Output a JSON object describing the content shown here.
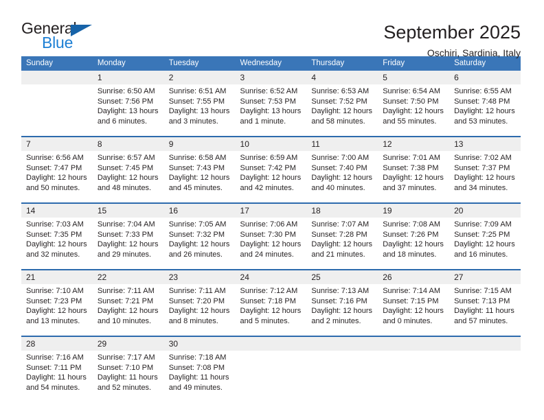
{
  "brand": {
    "word_one": "General",
    "word_two": "Blue",
    "triangle_icon": "triangle-icon",
    "accent_color": "#1763a8",
    "blue_color": "#1c7fd4"
  },
  "header": {
    "title": "September 2025",
    "location": "Oschiri, Sardinia, Italy"
  },
  "calendar": {
    "header_bg": "#3a76b8",
    "header_text_color": "#ffffff",
    "row_divider_color": "#2c6aad",
    "daynum_bg": "#efefef",
    "columns": [
      "Sunday",
      "Monday",
      "Tuesday",
      "Wednesday",
      "Thursday",
      "Friday",
      "Saturday"
    ],
    "weeks": [
      [
        {
          "day": "",
          "sunrise": "",
          "sunset": "",
          "daylight_a": "",
          "daylight_b": ""
        },
        {
          "day": "1",
          "sunrise": "Sunrise: 6:50 AM",
          "sunset": "Sunset: 7:56 PM",
          "daylight_a": "Daylight: 13 hours",
          "daylight_b": "and 6 minutes."
        },
        {
          "day": "2",
          "sunrise": "Sunrise: 6:51 AM",
          "sunset": "Sunset: 7:55 PM",
          "daylight_a": "Daylight: 13 hours",
          "daylight_b": "and 3 minutes."
        },
        {
          "day": "3",
          "sunrise": "Sunrise: 6:52 AM",
          "sunset": "Sunset: 7:53 PM",
          "daylight_a": "Daylight: 13 hours",
          "daylight_b": "and 1 minute."
        },
        {
          "day": "4",
          "sunrise": "Sunrise: 6:53 AM",
          "sunset": "Sunset: 7:52 PM",
          "daylight_a": "Daylight: 12 hours",
          "daylight_b": "and 58 minutes."
        },
        {
          "day": "5",
          "sunrise": "Sunrise: 6:54 AM",
          "sunset": "Sunset: 7:50 PM",
          "daylight_a": "Daylight: 12 hours",
          "daylight_b": "and 55 minutes."
        },
        {
          "day": "6",
          "sunrise": "Sunrise: 6:55 AM",
          "sunset": "Sunset: 7:48 PM",
          "daylight_a": "Daylight: 12 hours",
          "daylight_b": "and 53 minutes."
        }
      ],
      [
        {
          "day": "7",
          "sunrise": "Sunrise: 6:56 AM",
          "sunset": "Sunset: 7:47 PM",
          "daylight_a": "Daylight: 12 hours",
          "daylight_b": "and 50 minutes."
        },
        {
          "day": "8",
          "sunrise": "Sunrise: 6:57 AM",
          "sunset": "Sunset: 7:45 PM",
          "daylight_a": "Daylight: 12 hours",
          "daylight_b": "and 48 minutes."
        },
        {
          "day": "9",
          "sunrise": "Sunrise: 6:58 AM",
          "sunset": "Sunset: 7:43 PM",
          "daylight_a": "Daylight: 12 hours",
          "daylight_b": "and 45 minutes."
        },
        {
          "day": "10",
          "sunrise": "Sunrise: 6:59 AM",
          "sunset": "Sunset: 7:42 PM",
          "daylight_a": "Daylight: 12 hours",
          "daylight_b": "and 42 minutes."
        },
        {
          "day": "11",
          "sunrise": "Sunrise: 7:00 AM",
          "sunset": "Sunset: 7:40 PM",
          "daylight_a": "Daylight: 12 hours",
          "daylight_b": "and 40 minutes."
        },
        {
          "day": "12",
          "sunrise": "Sunrise: 7:01 AM",
          "sunset": "Sunset: 7:38 PM",
          "daylight_a": "Daylight: 12 hours",
          "daylight_b": "and 37 minutes."
        },
        {
          "day": "13",
          "sunrise": "Sunrise: 7:02 AM",
          "sunset": "Sunset: 7:37 PM",
          "daylight_a": "Daylight: 12 hours",
          "daylight_b": "and 34 minutes."
        }
      ],
      [
        {
          "day": "14",
          "sunrise": "Sunrise: 7:03 AM",
          "sunset": "Sunset: 7:35 PM",
          "daylight_a": "Daylight: 12 hours",
          "daylight_b": "and 32 minutes."
        },
        {
          "day": "15",
          "sunrise": "Sunrise: 7:04 AM",
          "sunset": "Sunset: 7:33 PM",
          "daylight_a": "Daylight: 12 hours",
          "daylight_b": "and 29 minutes."
        },
        {
          "day": "16",
          "sunrise": "Sunrise: 7:05 AM",
          "sunset": "Sunset: 7:32 PM",
          "daylight_a": "Daylight: 12 hours",
          "daylight_b": "and 26 minutes."
        },
        {
          "day": "17",
          "sunrise": "Sunrise: 7:06 AM",
          "sunset": "Sunset: 7:30 PM",
          "daylight_a": "Daylight: 12 hours",
          "daylight_b": "and 24 minutes."
        },
        {
          "day": "18",
          "sunrise": "Sunrise: 7:07 AM",
          "sunset": "Sunset: 7:28 PM",
          "daylight_a": "Daylight: 12 hours",
          "daylight_b": "and 21 minutes."
        },
        {
          "day": "19",
          "sunrise": "Sunrise: 7:08 AM",
          "sunset": "Sunset: 7:26 PM",
          "daylight_a": "Daylight: 12 hours",
          "daylight_b": "and 18 minutes."
        },
        {
          "day": "20",
          "sunrise": "Sunrise: 7:09 AM",
          "sunset": "Sunset: 7:25 PM",
          "daylight_a": "Daylight: 12 hours",
          "daylight_b": "and 16 minutes."
        }
      ],
      [
        {
          "day": "21",
          "sunrise": "Sunrise: 7:10 AM",
          "sunset": "Sunset: 7:23 PM",
          "daylight_a": "Daylight: 12 hours",
          "daylight_b": "and 13 minutes."
        },
        {
          "day": "22",
          "sunrise": "Sunrise: 7:11 AM",
          "sunset": "Sunset: 7:21 PM",
          "daylight_a": "Daylight: 12 hours",
          "daylight_b": "and 10 minutes."
        },
        {
          "day": "23",
          "sunrise": "Sunrise: 7:11 AM",
          "sunset": "Sunset: 7:20 PM",
          "daylight_a": "Daylight: 12 hours",
          "daylight_b": "and 8 minutes."
        },
        {
          "day": "24",
          "sunrise": "Sunrise: 7:12 AM",
          "sunset": "Sunset: 7:18 PM",
          "daylight_a": "Daylight: 12 hours",
          "daylight_b": "and 5 minutes."
        },
        {
          "day": "25",
          "sunrise": "Sunrise: 7:13 AM",
          "sunset": "Sunset: 7:16 PM",
          "daylight_a": "Daylight: 12 hours",
          "daylight_b": "and 2 minutes."
        },
        {
          "day": "26",
          "sunrise": "Sunrise: 7:14 AM",
          "sunset": "Sunset: 7:15 PM",
          "daylight_a": "Daylight: 12 hours",
          "daylight_b": "and 0 minutes."
        },
        {
          "day": "27",
          "sunrise": "Sunrise: 7:15 AM",
          "sunset": "Sunset: 7:13 PM",
          "daylight_a": "Daylight: 11 hours",
          "daylight_b": "and 57 minutes."
        }
      ],
      [
        {
          "day": "28",
          "sunrise": "Sunrise: 7:16 AM",
          "sunset": "Sunset: 7:11 PM",
          "daylight_a": "Daylight: 11 hours",
          "daylight_b": "and 54 minutes."
        },
        {
          "day": "29",
          "sunrise": "Sunrise: 7:17 AM",
          "sunset": "Sunset: 7:10 PM",
          "daylight_a": "Daylight: 11 hours",
          "daylight_b": "and 52 minutes."
        },
        {
          "day": "30",
          "sunrise": "Sunrise: 7:18 AM",
          "sunset": "Sunset: 7:08 PM",
          "daylight_a": "Daylight: 11 hours",
          "daylight_b": "and 49 minutes."
        },
        {
          "day": "",
          "sunrise": "",
          "sunset": "",
          "daylight_a": "",
          "daylight_b": ""
        },
        {
          "day": "",
          "sunrise": "",
          "sunset": "",
          "daylight_a": "",
          "daylight_b": ""
        },
        {
          "day": "",
          "sunrise": "",
          "sunset": "",
          "daylight_a": "",
          "daylight_b": ""
        },
        {
          "day": "",
          "sunrise": "",
          "sunset": "",
          "daylight_a": "",
          "daylight_b": ""
        }
      ]
    ]
  }
}
